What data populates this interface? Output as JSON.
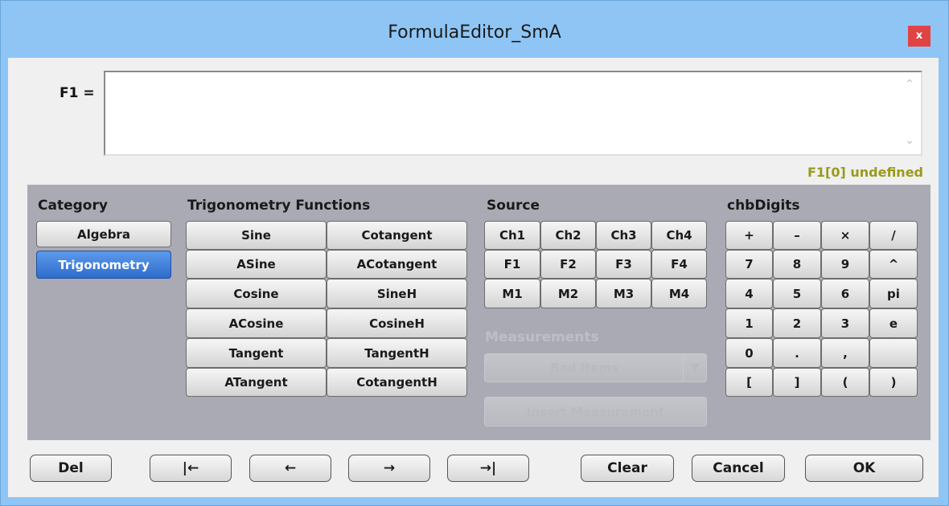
{
  "window": {
    "title": "FormulaEditor_SmA",
    "close_label": "x"
  },
  "formula": {
    "label": "F1 =",
    "value": "",
    "status": "F1[0] undefined"
  },
  "category": {
    "title": "Category",
    "items": [
      "Algebra",
      "Trigonometry"
    ],
    "selected": "Trigonometry"
  },
  "functions": {
    "title": "Trigonometry Functions",
    "items": [
      "Sine",
      "Cotangent",
      "ASine",
      "ACotangent",
      "Cosine",
      "SineH",
      "ACosine",
      "CosineH",
      "Tangent",
      "TangentH",
      "ATangent",
      "CotangentH"
    ]
  },
  "source": {
    "title": "Source",
    "items": [
      "Ch1",
      "Ch2",
      "Ch3",
      "Ch4",
      "F1",
      "F2",
      "F3",
      "F4",
      "M1",
      "M2",
      "M3",
      "M4"
    ]
  },
  "measurements": {
    "title": "Measurements",
    "dropdown_value": "Bad Items",
    "insert_label": "Insert Measurement",
    "enabled": false
  },
  "digits": {
    "title": "chbDigits",
    "items": [
      "+",
      "–",
      "×",
      "/",
      "7",
      "8",
      "9",
      "^",
      "4",
      "5",
      "6",
      "pi",
      "1",
      "2",
      "3",
      "e",
      "0",
      ".",
      ",",
      "",
      "[",
      "]",
      "(",
      ")"
    ]
  },
  "bottom": {
    "del": "Del",
    "home_icon": "|←",
    "left_icon": "←",
    "right_icon": "→",
    "end_icon": "→|",
    "clear": "Clear",
    "cancel": "Cancel",
    "ok": "OK"
  },
  "colors": {
    "accent": "#2e6ccc",
    "panel": "#aaaab4",
    "frame": "#8fc5f5",
    "status": "#9a9a1a"
  }
}
